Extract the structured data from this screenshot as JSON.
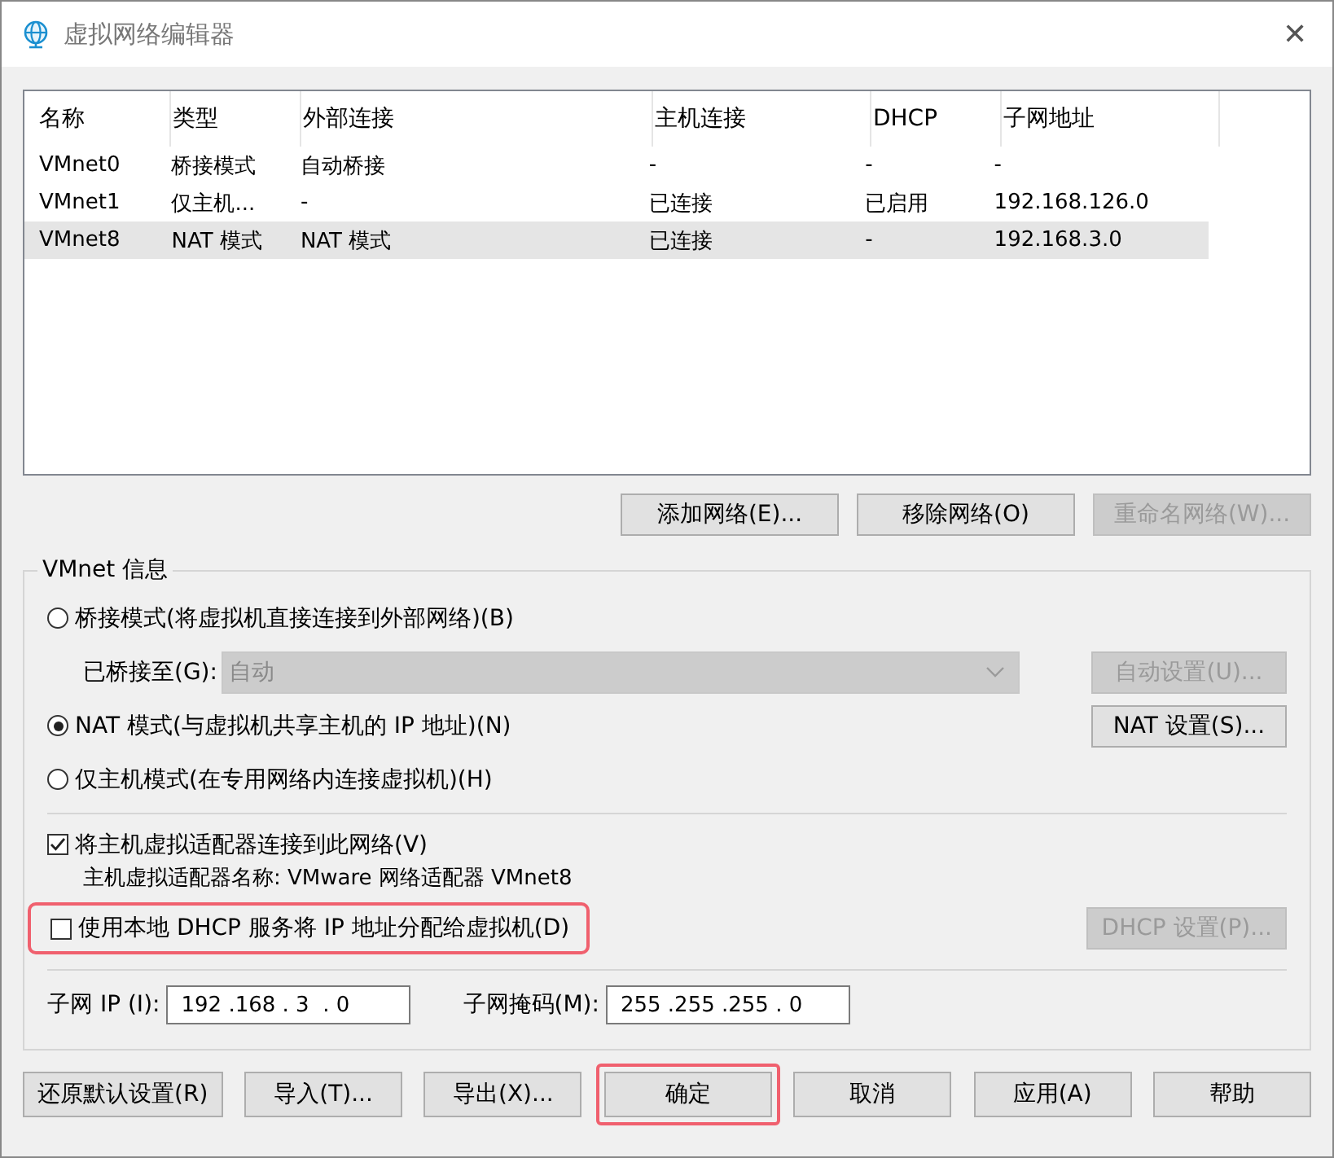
{
  "window": {
    "title": "虚拟网络编辑器",
    "close": "✕"
  },
  "list": {
    "columns": [
      "名称",
      "类型",
      "外部连接",
      "主机连接",
      "DHCP",
      "子网地址"
    ],
    "rows": [
      {
        "cells": [
          "VMnet0",
          "桥接模式",
          "自动桥接",
          "-",
          "-",
          "-"
        ],
        "selected": false
      },
      {
        "cells": [
          "VMnet1",
          "仅主机...",
          "-",
          "已连接",
          "已启用",
          "192.168.126.0"
        ],
        "selected": false
      },
      {
        "cells": [
          "VMnet8",
          "NAT 模式",
          "NAT 模式",
          "已连接",
          "-",
          "192.168.3.0"
        ],
        "selected": true
      }
    ]
  },
  "list_buttons": [
    {
      "label": "添加网络(E)...",
      "disabled": false
    },
    {
      "label": "移除网络(O)",
      "disabled": false
    },
    {
      "label": "重命名网络(W)...",
      "disabled": true
    }
  ],
  "vmnet_info": {
    "title": "VMnet 信息",
    "bridge_mode": {
      "label": "桥接模式(将虚拟机直接连接到外部网络)(B)",
      "selected": false
    },
    "bridged_to": {
      "label": "已桥接至(G):",
      "value": "自动",
      "disabled": true
    },
    "auto_settings_button": {
      "label": "自动设置(U)...",
      "disabled": true
    },
    "nat_mode": {
      "label": "NAT 模式(与虚拟机共享主机的 IP 地址)(N)",
      "selected": true
    },
    "nat_settings_button": {
      "label": "NAT 设置(S)...",
      "disabled": false
    },
    "host_only_mode": {
      "label": "仅主机模式(在专用网络内连接虚拟机)(H)",
      "selected": false
    },
    "connect_adapter": {
      "label": "将主机虚拟适配器连接到此网络(V)",
      "checked": true
    },
    "adapter_name": "主机虚拟适配器名称: VMware 网络适配器 VMnet8",
    "use_dhcp": {
      "label": "使用本地 DHCP 服务将 IP 地址分配给虚拟机(D)",
      "checked": false,
      "highlighted": true
    },
    "dhcp_settings_button": {
      "label": "DHCP 设置(P)...",
      "disabled": true
    },
    "subnet_ip": {
      "label": "子网 IP (I):",
      "value": "192 .168 . 3  . 0"
    },
    "subnet_mask": {
      "label": "子网掩码(M):",
      "value": "255 .255 .255 . 0"
    }
  },
  "footer_buttons": [
    {
      "label": "还原默认设置(R)",
      "highlighted": false
    },
    {
      "label": "导入(T)...",
      "highlighted": false
    },
    {
      "label": "导出(X)...",
      "highlighted": false
    },
    {
      "label": "确定",
      "highlighted": true
    },
    {
      "label": "取消",
      "highlighted": false
    },
    {
      "label": "应用(A)",
      "highlighted": false
    },
    {
      "label": "帮助",
      "highlighted": false
    }
  ]
}
